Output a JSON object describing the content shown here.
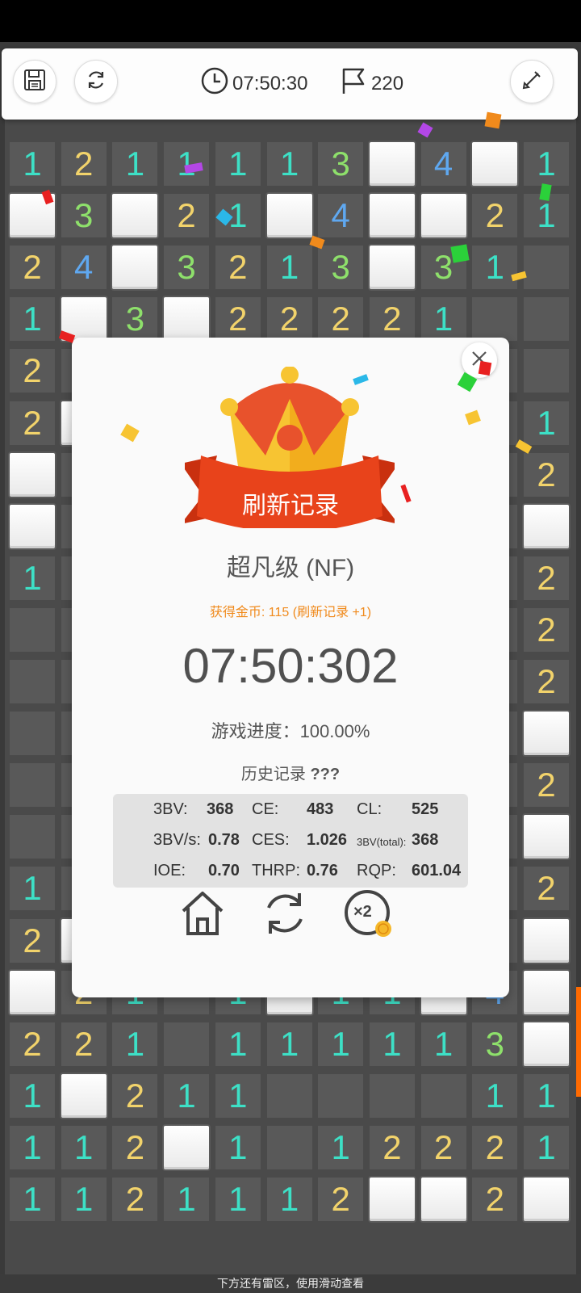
{
  "toolbar": {
    "save_icon": "save-icon",
    "restart_icon": "refresh-icon",
    "timer": "07:50:30",
    "flags": "220",
    "dig_icon": "shovel-icon"
  },
  "board": {
    "rows": [
      [
        "1",
        "2",
        "1",
        "1",
        "1",
        "1",
        "3",
        "#",
        "4",
        "#",
        "1"
      ],
      [
        "#",
        "3",
        "#",
        "2",
        "1",
        "#",
        "4",
        "#",
        "#",
        "2",
        "1"
      ],
      [
        "2",
        "4",
        "#",
        "3",
        "2",
        "1",
        "3",
        "#",
        "3",
        "1",
        ""
      ],
      [
        "1",
        "#",
        "3",
        "#",
        "2",
        "2",
        "2",
        "2",
        "1",
        "",
        ""
      ],
      [
        "2",
        "",
        "",
        "",
        "",
        "",
        "",
        "",
        "",
        "",
        ""
      ],
      [
        "2",
        "#",
        "",
        "",
        "",
        "",
        "",
        "",
        "",
        "",
        "1"
      ],
      [
        "#",
        "",
        "",
        "",
        "",
        "",
        "",
        "",
        "",
        "",
        "2"
      ],
      [
        "#",
        "",
        "",
        "",
        "",
        "",
        "",
        "",
        "",
        "",
        "#"
      ],
      [
        "1",
        "",
        "",
        "",
        "",
        "",
        "",
        "",
        "",
        "",
        "2"
      ],
      [
        "",
        "",
        "",
        "",
        "",
        "",
        "",
        "",
        "",
        "",
        "2"
      ],
      [
        "",
        "",
        "",
        "",
        "",
        "",
        "",
        "",
        "",
        "",
        "2"
      ],
      [
        "",
        "",
        "",
        "",
        "",
        "",
        "",
        "",
        "",
        "",
        "#"
      ],
      [
        "",
        "",
        "",
        "",
        "",
        "",
        "",
        "",
        "",
        "",
        "2"
      ],
      [
        "",
        "",
        "",
        "",
        "",
        "",
        "",
        "",
        "",
        "",
        "#"
      ],
      [
        "1",
        "",
        "",
        "",
        "",
        "",
        "",
        "",
        "",
        "",
        "2"
      ],
      [
        "2",
        "#",
        "",
        "",
        "",
        "",
        "",
        "",
        "",
        "",
        "#"
      ],
      [
        "#",
        "2",
        "1",
        "",
        "1",
        "#",
        "1",
        "1",
        "#",
        "4",
        "#"
      ],
      [
        "2",
        "2",
        "1",
        "",
        "1",
        "1",
        "1",
        "1",
        "1",
        "3",
        "#"
      ],
      [
        "1",
        "#",
        "2",
        "1",
        "1",
        "",
        "",
        "",
        "",
        "1",
        "1"
      ],
      [
        "1",
        "1",
        "2",
        "#",
        "1",
        "",
        "1",
        "2",
        "2",
        "2",
        "1"
      ],
      [
        "1",
        "1",
        "2",
        "1",
        "1",
        "1",
        "2",
        "#",
        "#",
        "2",
        "#"
      ]
    ]
  },
  "bottom_hint": "下方还有雷区，使用滑动查看",
  "dialog": {
    "banner": "刷新记录",
    "level": "超凡级 (NF)",
    "coins": "获得金币: 115 (刷新记录 +1)",
    "time": "07:50:302",
    "progress": "游戏进度：100.00%",
    "history_label": "历史记录",
    "history_value": "???",
    "stats": {
      "bbbv_label": "3BV:",
      "bbbv": "368",
      "ce_label": "CE:",
      "ce": "483",
      "cl_label": "CL:",
      "cl": "525",
      "bbbvs_label": "3BV/s:",
      "bbbvs": "0.78",
      "ces_label": "CES:",
      "ces": "1.026",
      "total_label": "3BV(total):",
      "total": "368",
      "ioe_label": "IOE:",
      "ioe": "0.70",
      "thrp_label": "THRP:",
      "thrp": "0.76",
      "rqp_label": "RQP:",
      "rqp": "601.04"
    },
    "home_icon": "home-icon",
    "replay_icon": "replay-icon",
    "double_icon": "double-coins-icon",
    "double_label": "×2"
  },
  "colors": {
    "n1": "#3de0c6",
    "n2": "#f2d36b",
    "n3": "#8ee06b",
    "n4": "#5fa8f0",
    "accent": "#f08a1c",
    "banner": "#e8431b"
  }
}
